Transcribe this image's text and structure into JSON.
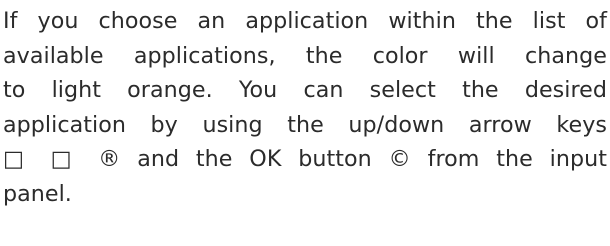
{
  "document": {
    "lines": [
      "If you choose an application within the list of",
      "available applications, the color will change",
      "to light orange. You can select the desired",
      "application by using the up/down arrow keys",
      "□ □ ® and the OK button © from the input",
      "panel."
    ]
  }
}
